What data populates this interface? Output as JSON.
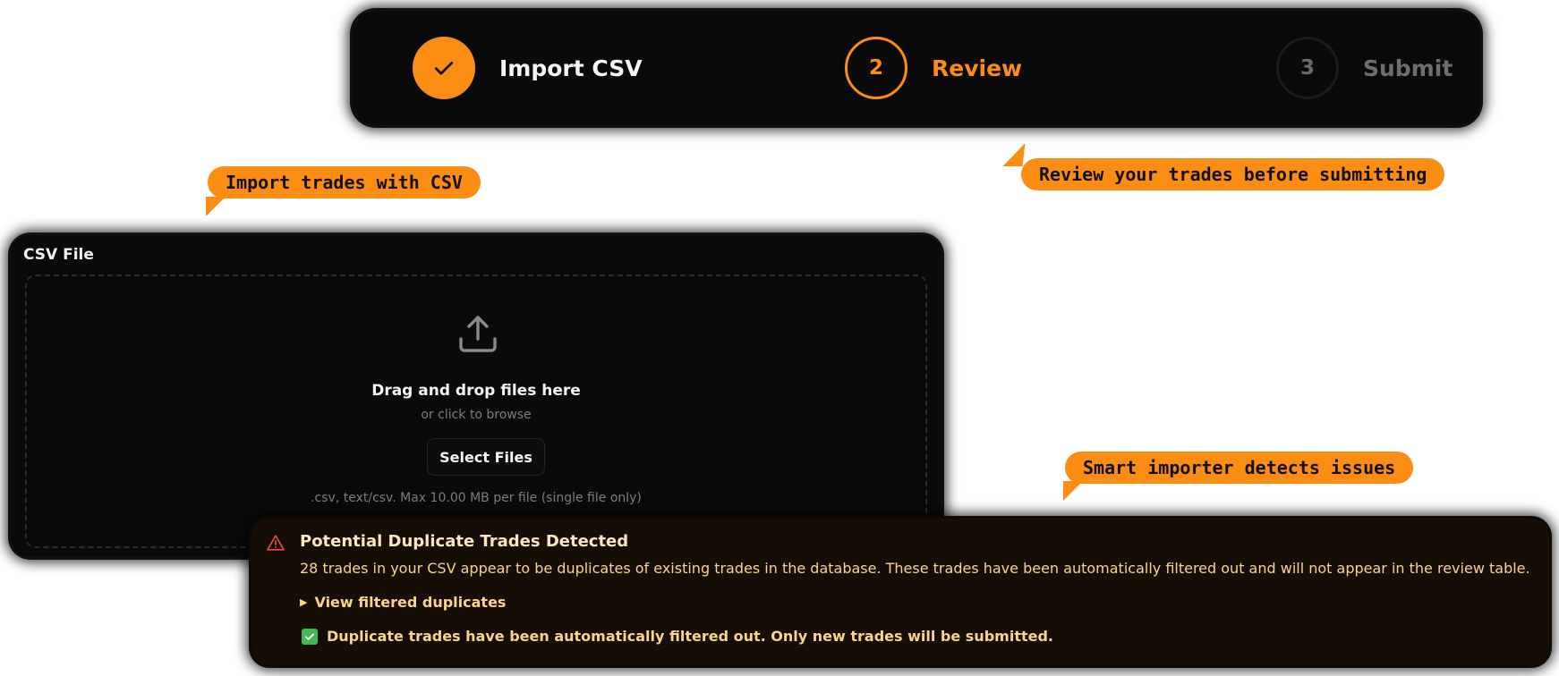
{
  "stepper": {
    "steps": [
      {
        "number": "1",
        "label": "Import CSV",
        "status": "completed"
      },
      {
        "number": "2",
        "label": "Review",
        "status": "active"
      },
      {
        "number": "3",
        "label": "Submit",
        "status": "pending"
      }
    ]
  },
  "callouts": {
    "import": "Import trades with CSV",
    "review": "Review your trades before submitting",
    "smart": "Smart importer detects issues"
  },
  "csv": {
    "title": "CSV File",
    "drop_title": "Drag and drop files here",
    "drop_subtitle": "or click to browse",
    "button": "Select Files",
    "note": ".csv, text/csv. Max 10.00 MB per file (single file only)"
  },
  "alert": {
    "title": "Potential Duplicate Trades Detected",
    "description": "28 trades in your CSV appear to be duplicates of existing trades in the database. These trades have been automatically filtered out and will not appear in the review table.",
    "details_label": "View filtered duplicates",
    "success_message": "Duplicate trades have been automatically filtered out. Only new trades will be submitted."
  },
  "colors": {
    "accent": "#fb8c14",
    "card_bg": "#0a0a0a",
    "warning_text": "#fad489",
    "warning_icon": "#e5484d",
    "success": "#3fb950"
  }
}
